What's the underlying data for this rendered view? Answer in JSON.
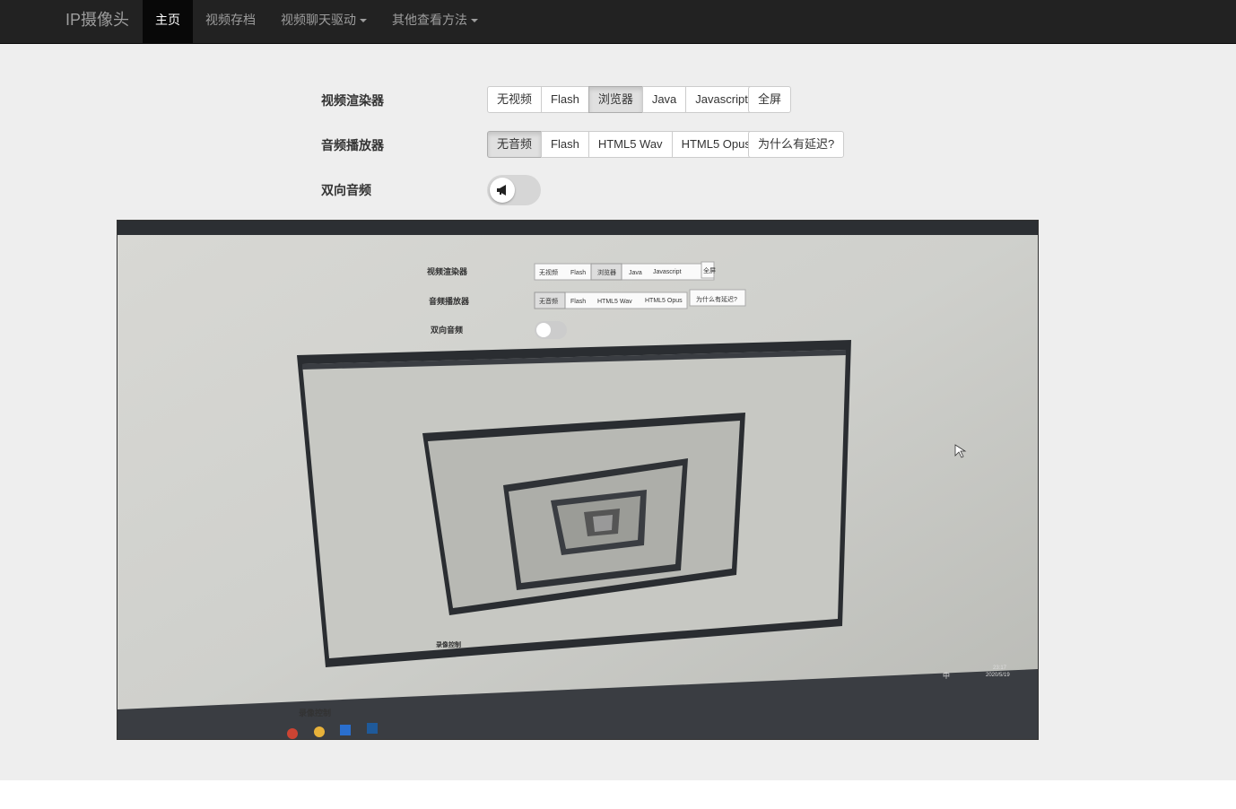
{
  "navbar": {
    "brand": "IP摄像头",
    "items": [
      {
        "label": "主页",
        "active": true
      },
      {
        "label": "视频存档"
      },
      {
        "label": "视频聊天驱动",
        "dropdown": true
      },
      {
        "label": "其他查看方法",
        "dropdown": true
      }
    ]
  },
  "video_renderer": {
    "label": "视频渲染器",
    "options": [
      "无视频",
      "Flash",
      "浏览器",
      "Java",
      "Javascript"
    ],
    "selected": "浏览器",
    "fullscreen_label": "全屏"
  },
  "audio_player": {
    "label": "音频播放器",
    "options": [
      "无音频",
      "Flash",
      "HTML5 Wav",
      "HTML5 Opus"
    ],
    "selected": "无音频",
    "why_delay_label": "为什么有延迟?"
  },
  "two_way_audio": {
    "label": "双向音频",
    "icon": "megaphone-icon",
    "enabled": false
  },
  "video_feed": {
    "inner_labels": {
      "video_renderer": "视频渲染器",
      "audio_player": "音频播放器",
      "two_way_audio": "双向音频",
      "record_control": "录像控制",
      "record_control_inner": "录像控制"
    },
    "inner_video_options": [
      "无视频",
      "Flash",
      "浏览器",
      "Java",
      "Javascript"
    ],
    "inner_fullscreen": "全屏",
    "inner_audio_options": [
      "无音频",
      "Flash",
      "HTML5 Wav",
      "HTML5 Opus"
    ],
    "inner_why_delay": "为什么有延迟?",
    "taskbar_time": "23:17",
    "taskbar_date": "2020/5/19",
    "taskbar_lang": "中"
  }
}
